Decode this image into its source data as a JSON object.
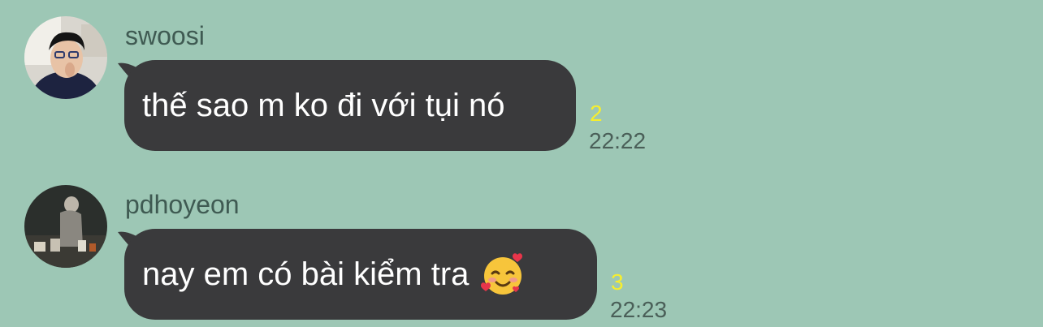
{
  "messages": [
    {
      "sender": "swoosi",
      "avatar_icon": "profile-photo-person-with-glasses",
      "text": "thế sao m ko đi với tụi nó",
      "unread_count": "2",
      "time": "22:22"
    },
    {
      "sender": "pdhoyeon",
      "avatar_icon": "profile-photo-dark-scene",
      "text": "nay em có bài kiểm tra",
      "emoji": "smiling-face-with-hearts",
      "unread_count": "3",
      "time": "22:23"
    }
  ],
  "colors": {
    "background": "#9dc7b5",
    "bubble": "#3a3a3c",
    "bubble_text": "#ffffff",
    "unread": "#f6ee2e",
    "meta_text": "#4a5f58"
  }
}
